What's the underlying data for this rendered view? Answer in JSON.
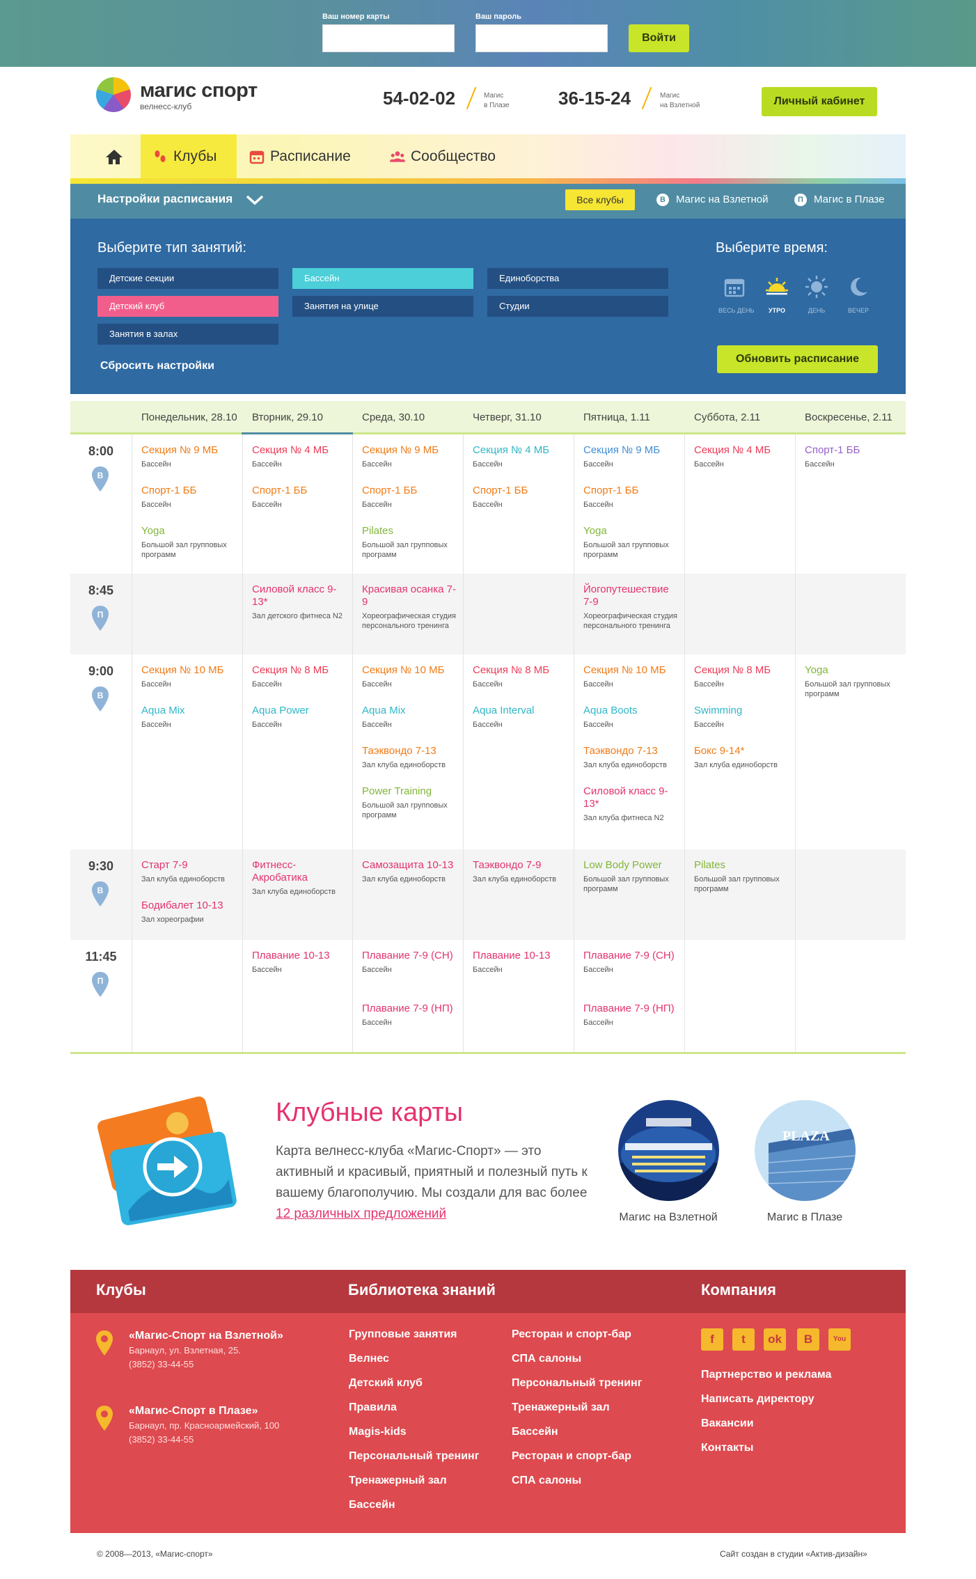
{
  "login": {
    "card_label": "Ваш номер карты",
    "password_label": "Ваш пароль",
    "card_value": "",
    "password_value": "",
    "submit": "Войти"
  },
  "header": {
    "logo_text": "магис спорт",
    "logo_sub": "велнесс-клуб",
    "phone1": "54-02-02",
    "phone1_note1": "Магис",
    "phone1_note2": "в Плазе",
    "phone2": "36-15-24",
    "phone2_note1": "Магис",
    "phone2_note2": "на Взлетной",
    "cabinet": "Личный кабинет"
  },
  "nav": {
    "tabs": [
      "Клубы",
      "Расписание",
      "Сообщество"
    ],
    "active": "Клубы"
  },
  "settings": {
    "title": "Настройки расписания",
    "all_clubs": "Все клубы",
    "club1_badge": "В",
    "club1": "Магис на Взлетной",
    "club2_badge": "П",
    "club2": "Магис в Плазе"
  },
  "filter": {
    "type_title": "Выберите тип занятий:",
    "types": [
      "Детские секции",
      "Бассейн",
      "Единоборства",
      "Детский клуб",
      "Занятия на улице",
      "Студии",
      "Занятия в залах"
    ],
    "selected_types": [
      "Бассейн",
      "Детский клуб"
    ],
    "reset": "Сбросить настройки",
    "time_title": "Выберите время:",
    "times": [
      "ВЕСЬ ДЕНЬ",
      "УТРО",
      "ДЕНЬ",
      "ВЕЧЕР"
    ],
    "selected_time": "УТРО",
    "refresh": "Обновить расписание"
  },
  "schedule": {
    "days": [
      "Понедельник, 28.10",
      "Вторник, 29.10",
      "Среда, 30.10",
      "Четверг, 31.10",
      "Пятница, 1.11",
      "Суббота, 2.11",
      "Воскресенье, 2.11"
    ],
    "rows": [
      {
        "time": "8:00",
        "club": "В",
        "cells": [
          [
            {
              "t": "Секция № 9 МБ",
              "s": "Бассейн"
            },
            {
              "t": "Спорт-1 ББ",
              "s": "Бассейн"
            },
            {
              "t": "Yoga",
              "s": "Большой зал групповых программ"
            }
          ],
          [
            {
              "t": "Секция № 4 МБ",
              "s": "Бассейн"
            },
            {
              "t": "Спорт-1 ББ",
              "s": "Бассейн"
            }
          ],
          [
            {
              "t": "Секция № 9 МБ",
              "s": "Бассейн"
            },
            {
              "t": "Спорт-1 ББ",
              "s": "Бассейн"
            },
            {
              "t": "Pilates",
              "s": "Большой зал групповых программ"
            }
          ],
          [
            {
              "t": "Секция № 4 МБ",
              "s": "Бассейн"
            },
            {
              "t": "Спорт-1 ББ",
              "s": "Бассейн"
            }
          ],
          [
            {
              "t": "Секция № 9 МБ",
              "s": "Бассейн"
            },
            {
              "t": "Спорт-1 ББ",
              "s": "Бассейн"
            },
            {
              "t": "Yoga",
              "s": "Большой зал групповых программ"
            }
          ],
          [
            {
              "t": "Секция № 4 МБ",
              "s": "Бассейн"
            }
          ],
          [
            {
              "t": "Спорт-1 ББ",
              "s": "Бассейн"
            }
          ]
        ]
      },
      {
        "time": "8:45",
        "club": "П",
        "cells": [
          [],
          [
            {
              "t": "Силовой класс 9-13*",
              "s": "Зал детского фитнеса N2"
            }
          ],
          [
            {
              "t": "Красивая осанка 7-9",
              "s": "Хореографическая студия персонального тренинга"
            }
          ],
          [],
          [
            {
              "t": "Йогопутешествие 7-9",
              "s": "Хореографическая студия персонального тренинга"
            }
          ],
          [],
          []
        ]
      },
      {
        "time": "9:00",
        "club": "В",
        "cells": [
          [
            {
              "t": "Секция № 10 МБ",
              "s": "Бассейн"
            },
            {
              "t": "Aqua Mix",
              "s": "Бассейн"
            }
          ],
          [
            {
              "t": "Секция № 8 МБ",
              "s": "Бассейн"
            },
            {
              "t": "Aqua Power",
              "s": "Бассейн"
            }
          ],
          [
            {
              "t": "Секция № 10 МБ",
              "s": "Бассейн"
            },
            {
              "t": "Aqua Mix",
              "s": "Бассейн"
            },
            {
              "t": "Таэквондо 7-13",
              "s": "Зал клуба единоборств"
            },
            {
              "t": "Power Training",
              "s": "Большой зал групповых программ"
            }
          ],
          [
            {
              "t": "Секция № 8 МБ",
              "s": "Бассейн"
            },
            {
              "t": "Aqua Interval",
              "s": "Бассейн"
            }
          ],
          [
            {
              "t": "Секция № 10 МБ",
              "s": "Бассейн"
            },
            {
              "t": "Aqua Boots",
              "s": "Бассейн"
            },
            {
              "t": "Таэквондо 7-13",
              "s": "Зал клуба единоборств"
            },
            {
              "t": "Силовой класс 9-13*",
              "s": "Зал клуба фитнеса N2"
            }
          ],
          [
            {
              "t": "Секция № 8 МБ",
              "s": "Бассейн"
            },
            {
              "t": "Swimming",
              "s": "Бассейн"
            },
            {
              "t": "Бокс 9-14*",
              "s": "Зал клуба единоборств"
            }
          ],
          [
            {
              "t": "Yoga",
              "s": "Большой зал групповых программ"
            }
          ]
        ]
      },
      {
        "time": "9:30",
        "club": "В",
        "cells": [
          [
            {
              "t": "Старт 7-9",
              "s": "Зал клуба единоборств"
            },
            {
              "t": "Бодибалет 10-13",
              "s": "Зал хореографии"
            }
          ],
          [
            {
              "t": "Фитнесс-Акробатика",
              "s": "Зал клуба единоборств"
            }
          ],
          [
            {
              "t": "Самозащита 10-13",
              "s": "Зал клуба единоборств"
            }
          ],
          [
            {
              "t": "Таэквондо 7-9",
              "s": "Зал клуба единоборств"
            }
          ],
          [
            {
              "t": "Low Body Power",
              "s": "Большой зал групповых программ"
            }
          ],
          [
            {
              "t": "Pilates",
              "s": "Большой зал групповых программ"
            }
          ],
          []
        ]
      },
      {
        "time": "11:45",
        "club": "П",
        "cells": [
          [],
          [
            {
              "t": "Плавание 10-13",
              "s": "Бассейн"
            }
          ],
          [
            {
              "t": "Плавание 7-9 (СН)",
              "s": "Бассейн"
            },
            {
              "t": "Плавание 7-9 (НП)",
              "s": "Бассейн"
            }
          ],
          [
            {
              "t": "Плавание 10-13",
              "s": "Бассейн"
            }
          ],
          [
            {
              "t": "Плавание 7-9 (СН)",
              "s": "Бассейн"
            },
            {
              "t": "Плавание 7-9 (НП)",
              "s": "Бассейн"
            }
          ],
          [],
          []
        ]
      }
    ]
  },
  "cards": {
    "title": "Клубные карты",
    "text": "Карта велнесс-клуба «Магис-Спорт» — это активный и красивый, приятный и полезный путь к вашему благополучию. Мы создали для вас более",
    "link": "12 различных предложений",
    "club1": "Магис на Взлетной",
    "club2": "Магис в Плазе",
    "photo2_text": "PLAZA"
  },
  "footer": {
    "clubs_title": "Клубы",
    "library_title": "Библиотека знаний",
    "company_title": "Компания",
    "club1_name": "«Магис-Спорт на Взлетной»",
    "club1_addr": "Барнаул, ул. Взлетная, 25.",
    "club1_phone": "(3852) 33-44-55",
    "club2_name": "«Магис-Спорт в Плазе»",
    "club2_addr": "Барнаул, пр. Красноармейский, 100",
    "club2_phone": "(3852) 33-44-55",
    "library_col1": [
      "Групповые занятия",
      "Велнес",
      "Детский клуб",
      "Правила",
      "Magis-kids",
      "Персональный тренинг",
      "Тренажерный зал",
      "Бассейн"
    ],
    "library_col2": [
      "Ресторан и спорт-бар",
      "СПА салоны",
      "Персональный тренинг",
      "Тренажерный зал",
      "Бассейн",
      "Ресторан и спорт-бар",
      "СПА салоны"
    ],
    "social": [
      "facebook-icon",
      "twitter-icon",
      "odnoklassniki-icon",
      "vkontakte-icon",
      "youtube-icon"
    ],
    "company_links": [
      "Партнерство и реклама",
      "Написать директору",
      "Вакансии",
      "Контакты"
    ],
    "copyright": "© 2008—2013, «Магис-спорт»",
    "credit": "Сайт создан в студии «Актив-дизайн»"
  }
}
